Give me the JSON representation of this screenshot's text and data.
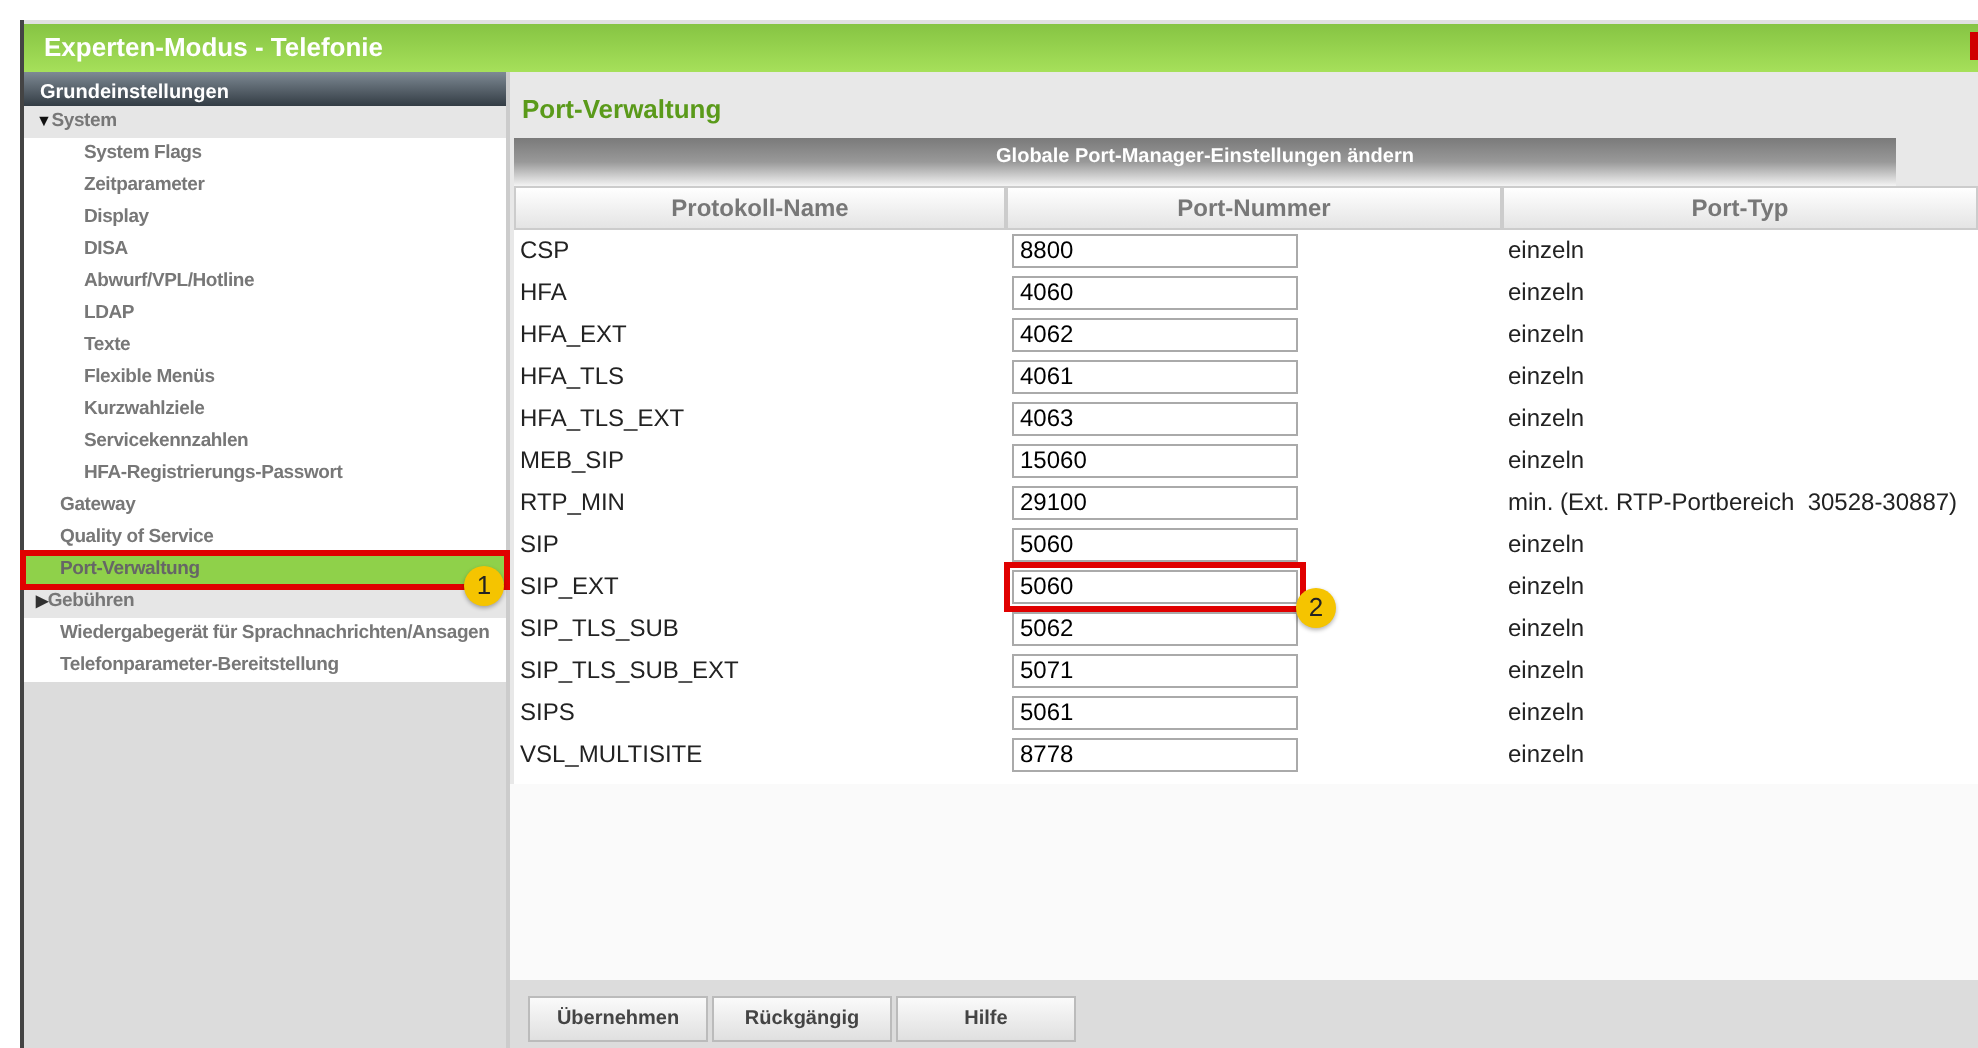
{
  "window": {
    "title": "Experten-Modus - Telefonie"
  },
  "sidebar": {
    "header": "Grundeinstellungen",
    "items": [
      {
        "kind": "group",
        "label": "System",
        "expander": "▼",
        "expanded": true,
        "selected": false,
        "children": [
          {
            "kind": "link",
            "label": "System Flags",
            "selected": false
          },
          {
            "kind": "link",
            "label": "Zeitparameter",
            "selected": false
          },
          {
            "kind": "link",
            "label": "Display",
            "selected": false
          },
          {
            "kind": "link",
            "label": "DISA",
            "selected": false
          },
          {
            "kind": "link",
            "label": "Abwurf/VPL/Hotline",
            "selected": false
          },
          {
            "kind": "link",
            "label": "LDAP",
            "selected": false
          },
          {
            "kind": "link",
            "label": "Texte",
            "selected": false
          },
          {
            "kind": "link",
            "label": "Flexible Menüs",
            "selected": false
          },
          {
            "kind": "link",
            "label": "Kurzwahlziele",
            "selected": false
          },
          {
            "kind": "link",
            "label": "Servicekennzahlen",
            "selected": false
          },
          {
            "kind": "link",
            "label": "HFA-Registrierungs-Passwort",
            "selected": false
          }
        ]
      },
      {
        "kind": "link",
        "label": "Gateway",
        "selected": false
      },
      {
        "kind": "link",
        "label": "Quality of Service",
        "selected": false
      },
      {
        "kind": "link",
        "label": "Port-Verwaltung",
        "selected": true,
        "callout": "1"
      },
      {
        "kind": "group",
        "label": "Gebühren",
        "expander": "▶",
        "expanded": false,
        "selected": false
      },
      {
        "kind": "link",
        "label": "Wiedergabegerät für Sprachnachrichten/Ansagen",
        "selected": false
      },
      {
        "kind": "link",
        "label": "Telefonparameter-Bereitstellung",
        "selected": false
      }
    ]
  },
  "main": {
    "title": "Port-Verwaltung",
    "section": "Globale Port-Manager-Einstellungen ändern",
    "table": {
      "columns": [
        "Protokoll-Name",
        "Port-Nummer",
        "Port-Typ"
      ],
      "rows": [
        {
          "name": "CSP",
          "port": "8800",
          "type": "einzeln"
        },
        {
          "name": "HFA",
          "port": "4060",
          "type": "einzeln"
        },
        {
          "name": "HFA_EXT",
          "port": "4062",
          "type": "einzeln"
        },
        {
          "name": "HFA_TLS",
          "port": "4061",
          "type": "einzeln"
        },
        {
          "name": "HFA_TLS_EXT",
          "port": "4063",
          "type": "einzeln"
        },
        {
          "name": "MEB_SIP",
          "port": "15060",
          "type": "einzeln"
        },
        {
          "name": "RTP_MIN",
          "port": "29100",
          "type": "min. (Ext. RTP-Portbereich  30528-30887)"
        },
        {
          "name": "SIP",
          "port": "5060",
          "type": "einzeln"
        },
        {
          "name": "SIP_EXT",
          "port": "5060",
          "type": "einzeln",
          "callout": "2"
        },
        {
          "name": "SIP_TLS_SUB",
          "port": "5062",
          "type": "einzeln"
        },
        {
          "name": "SIP_TLS_SUB_EXT",
          "port": "5071",
          "type": "einzeln"
        },
        {
          "name": "SIPS",
          "port": "5061",
          "type": "einzeln"
        },
        {
          "name": "VSL_MULTISITE",
          "port": "8778",
          "type": "einzeln"
        }
      ]
    },
    "buttons": [
      "Übernehmen",
      "Rückgängig",
      "Hilfe"
    ]
  }
}
